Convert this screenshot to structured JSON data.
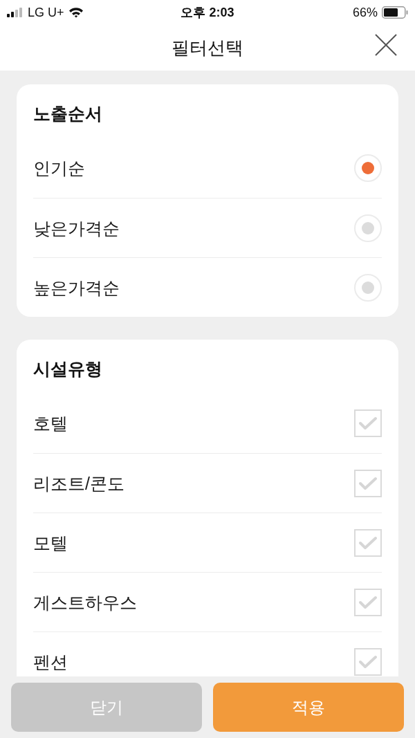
{
  "status_bar": {
    "carrier": "LG U+",
    "time": "오후 2:03",
    "battery": "66%"
  },
  "header": {
    "title": "필터선택"
  },
  "sections": [
    {
      "title": "노출순서",
      "kind": "radio",
      "options": [
        {
          "label": "인기순",
          "selected": true
        },
        {
          "label": "낮은가격순",
          "selected": false
        },
        {
          "label": "높은가격순",
          "selected": false
        }
      ]
    },
    {
      "title": "시설유형",
      "kind": "checkbox",
      "options": [
        {
          "label": "호텔",
          "checked": false
        },
        {
          "label": "리조트/콘도",
          "checked": false
        },
        {
          "label": "모텔",
          "checked": false
        },
        {
          "label": "게스트하우스",
          "checked": false
        },
        {
          "label": "펜션",
          "checked": false
        }
      ]
    }
  ],
  "buttons": [
    {
      "label": "닫기",
      "kind": "secondary"
    },
    {
      "label": "적용",
      "kind": "primary"
    }
  ]
}
